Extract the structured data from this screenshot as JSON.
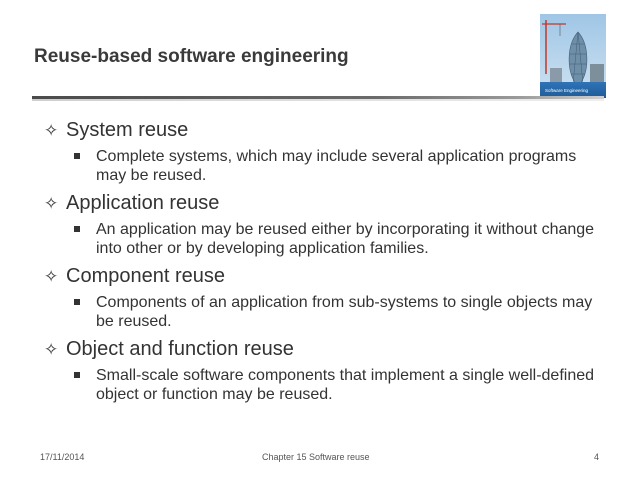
{
  "slide": {
    "title": "Reuse-based software engineering"
  },
  "cover": {
    "title_line1": "Software Engineering"
  },
  "items": [
    {
      "marker": "✧",
      "heading": "System reuse",
      "sub": "Complete systems, which may include several application programs may be reused."
    },
    {
      "marker": "✧",
      "heading": "Application reuse",
      "sub": "An application may be reused either by incorporating it without change into other or by developing application families."
    },
    {
      "marker": "✧",
      "heading": "Component reuse",
      "sub": "Components of an application from sub-systems to single objects may be reused."
    },
    {
      "marker": "✧",
      "heading": "Object and function reuse",
      "sub": "Small-scale software components that implement a single well-defined object or function may be reused."
    }
  ],
  "footer": {
    "date": "17/11/2014",
    "chapter": "Chapter 15 Software reuse",
    "page": "4"
  },
  "colors": {
    "text": "#333333",
    "title": "#3a3a3a",
    "cover_blue": "#2d6fb3"
  }
}
